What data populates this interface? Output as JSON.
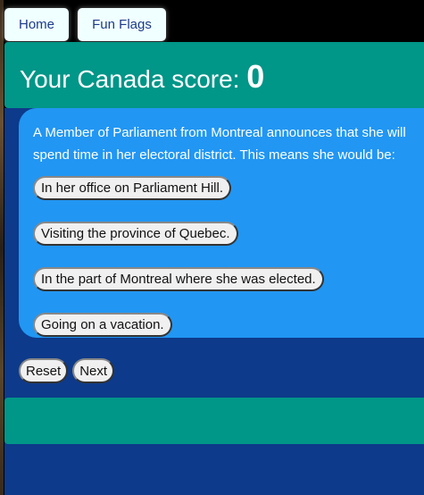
{
  "nav": {
    "home": "Home",
    "fun_flags": "Fun Flags"
  },
  "header": {
    "title": "Your Canada score:",
    "score": "0"
  },
  "quiz": {
    "question": "A Member of Parliament from Montreal announces that she will spend time in her electoral district. This means she would be:",
    "options": [
      "In her office on Parliament Hill.",
      "Visiting the province of Quebec.",
      "In the part of Montreal where she was elected.",
      "Going on a vacation."
    ]
  },
  "controls": {
    "reset": "Reset",
    "next": "Next"
  },
  "colors": {
    "header": "#009688",
    "main": "#0d3a8a",
    "card": "#2196f3"
  }
}
